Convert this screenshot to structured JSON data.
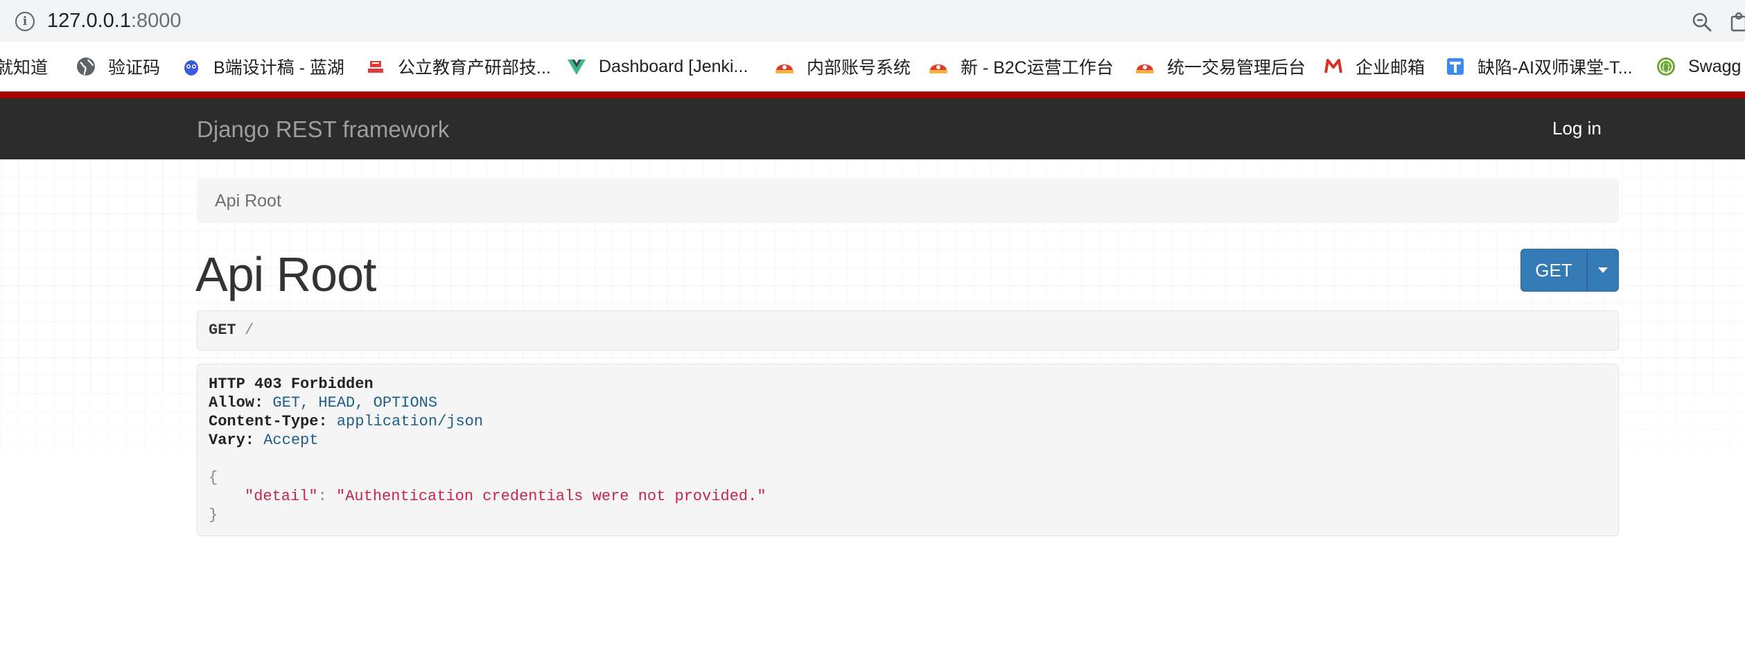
{
  "browser": {
    "url_host": "127.0.0.1",
    "url_port": ":8000",
    "info_icon": "info-icon",
    "zoom_icon": "zoom-icon",
    "extension_icon": "extension-icon"
  },
  "bookmarks": [
    {
      "label": "就知道",
      "icon": "none"
    },
    {
      "label": "验证码",
      "icon": "globe-icon"
    },
    {
      "label": "B端设计稿 - 蓝湖",
      "icon": "lanhu-icon"
    },
    {
      "label": "公立教育产研部技...",
      "icon": "company-icon"
    },
    {
      "label": "Dashboard [Jenki...",
      "icon": "vue-icon"
    },
    {
      "label": "内部账号系统",
      "icon": "red-helmet-icon"
    },
    {
      "label": "新 - B2C运营工作台",
      "icon": "red-helmet-icon"
    },
    {
      "label": "统一交易管理后台",
      "icon": "red-helmet-icon"
    },
    {
      "label": "企业邮箱",
      "icon": "mail-m-icon"
    },
    {
      "label": "缺陷-AI双师课堂-T...",
      "icon": "tapd-icon"
    },
    {
      "label": "Swagg",
      "icon": "swagger-icon"
    }
  ],
  "colors": {
    "stripe": "#a30000",
    "navbar": "#2c2c2c",
    "button": "#337ab7"
  },
  "navbar": {
    "brand": "Django REST framework",
    "login": "Log in"
  },
  "breadcrumb": {
    "current": "Api Root"
  },
  "page": {
    "title": "Api Root",
    "get_button": "GET"
  },
  "request": {
    "method": "GET",
    "path": "/"
  },
  "response": {
    "status": "HTTP 403 Forbidden",
    "headers": [
      {
        "name": "Allow:",
        "value": "GET, HEAD, OPTIONS"
      },
      {
        "name": "Content-Type:",
        "value": "application/json"
      },
      {
        "name": "Vary:",
        "value": "Accept"
      }
    ],
    "open_brace": "{",
    "body_key": "\"detail\"",
    "colon": ":",
    "body_value": "\"Authentication credentials were not provided.\"",
    "close_brace": "}"
  }
}
